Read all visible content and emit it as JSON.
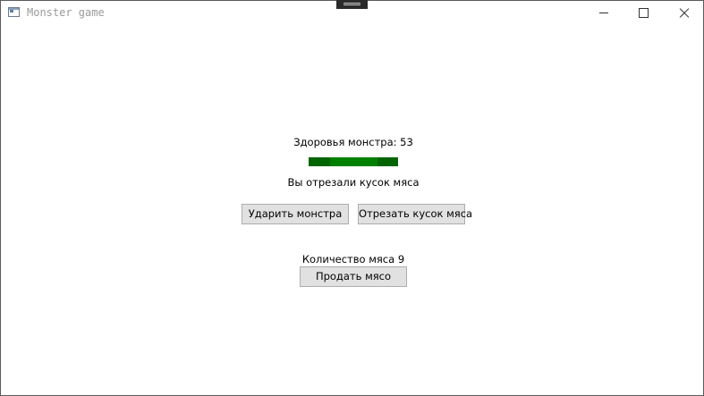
{
  "window": {
    "title": "Monster game",
    "icon": "app-window-icon"
  },
  "monster": {
    "health_label": "Здоровья монстра: 53",
    "health_value": 53,
    "health_max": 100,
    "health_color": "#008000",
    "health_track_color": "#006400"
  },
  "status": {
    "message": "Вы отрезали кусок мяса"
  },
  "actions": {
    "hit_label": "Ударить монстра",
    "cut_label": "Отрезать кусок мяса"
  },
  "inventory": {
    "meat_label": "Количество мяса 9",
    "sell_label": "Продать мясо"
  }
}
